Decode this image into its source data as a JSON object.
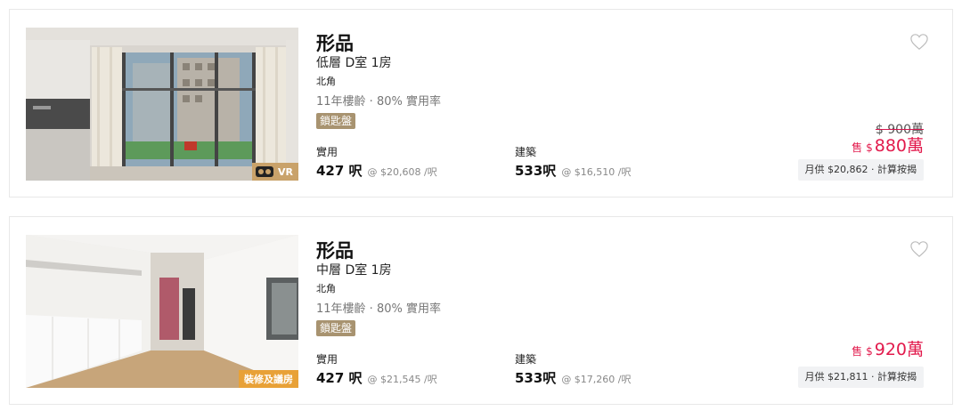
{
  "listings": [
    {
      "title": "形品",
      "unit": "低層 D室 1房",
      "district": "北角",
      "age_info": "11年樓齡 · 80% 實用率",
      "tag": "鎖匙盤",
      "badge": "VR",
      "saleable_label": "實用",
      "saleable_area": "427 呎",
      "saleable_ppf": "@ $20,608 /呎",
      "gross_label": "建築",
      "gross_area": "533呎",
      "gross_ppf": "@ $16,510 /呎",
      "old_price": "$ 900萬",
      "sell_label": "售",
      "currency": "$",
      "price": "880萬",
      "mortgage": "月供 $20,862 · 計算按揭",
      "favorite_icon": "heart-outline-icon"
    },
    {
      "title": "形品",
      "unit": "中層 D室 1房",
      "district": "北角",
      "age_info": "11年樓齡 · 80% 實用率",
      "tag": "鎖匙盤",
      "badge": "裝修及議房",
      "saleable_label": "實用",
      "saleable_area": "427 呎",
      "saleable_ppf": "@ $21,545 /呎",
      "gross_label": "建築",
      "gross_area": "533呎",
      "gross_ppf": "@ $17,260 /呎",
      "sell_label": "售",
      "currency": "$",
      "price": "920萬",
      "mortgage": "月供 $21,811 · 計算按揭",
      "favorite_icon": "heart-outline-icon"
    }
  ],
  "colors": {
    "price": "#e21a4c",
    "tag": "#a89370",
    "vr_badge": "#c9a26a",
    "reno_badge": "#e8a137"
  }
}
